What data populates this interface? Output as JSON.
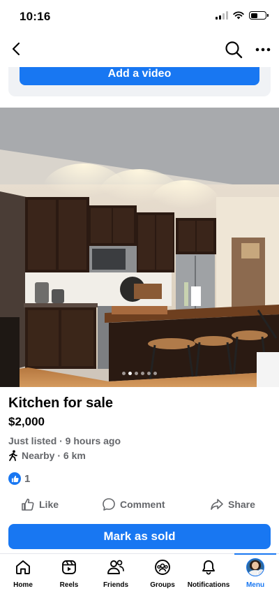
{
  "status_bar": {
    "time": "10:16",
    "battery_level": 0.45
  },
  "nav": {
    "back_icon": "chevron-left-icon",
    "search_icon": "search-icon",
    "more_icon": "more-horizontal-icon"
  },
  "add_video": {
    "label": "Add a video"
  },
  "photo": {
    "carousel_count": 6,
    "carousel_active_index": 1
  },
  "listing": {
    "title": "Kitchen for sale",
    "price": "$2,000",
    "meta": "Just listed · 9 hours ago",
    "distance": "Nearby · 6 km",
    "reaction_count": "1"
  },
  "actions": {
    "like": "Like",
    "comment": "Comment",
    "share": "Share"
  },
  "mark_sold": {
    "label": "Mark as sold"
  },
  "tabs": [
    {
      "label": "Home",
      "icon": "home-icon"
    },
    {
      "label": "Reels",
      "icon": "reels-icon"
    },
    {
      "label": "Friends",
      "icon": "friends-icon"
    },
    {
      "label": "Groups",
      "icon": "groups-icon"
    },
    {
      "label": "Notifications",
      "icon": "bell-icon"
    },
    {
      "label": "Menu",
      "icon": "avatar"
    }
  ],
  "colors": {
    "accent": "#1877f2",
    "secondary_text": "#65676b"
  }
}
